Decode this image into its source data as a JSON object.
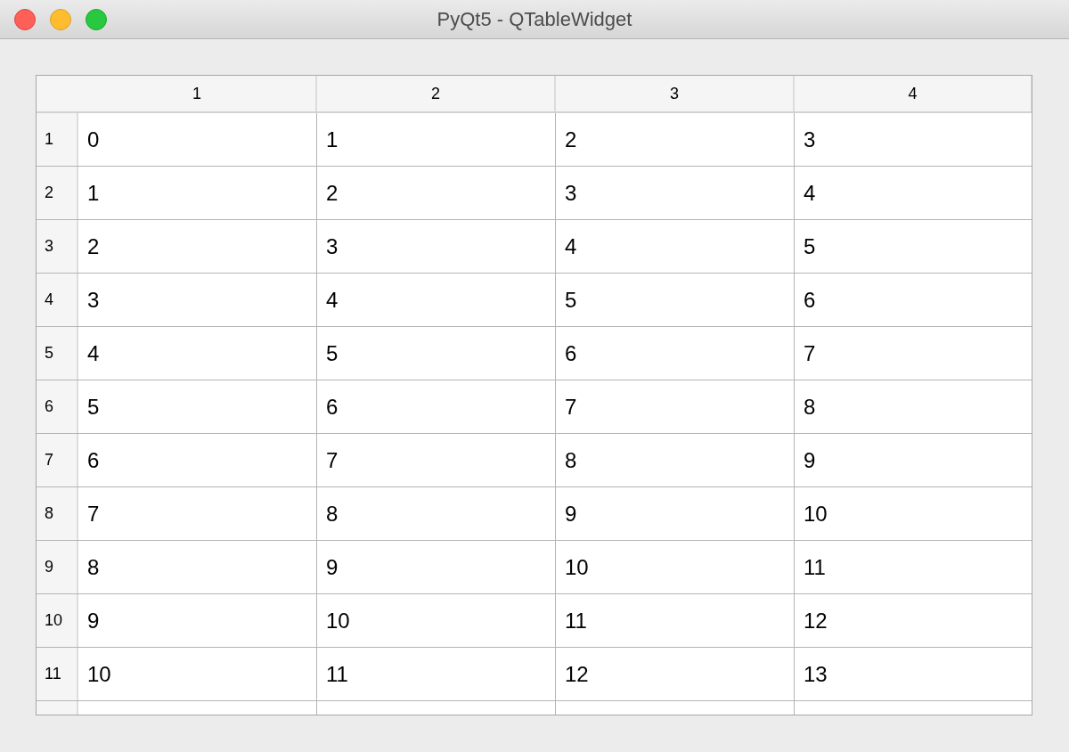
{
  "window": {
    "title": "PyQt5 - QTableWidget"
  },
  "table": {
    "columns": [
      "1",
      "2",
      "3",
      "4"
    ],
    "rows": [
      {
        "header": "1",
        "cells": [
          "0",
          "1",
          "2",
          "3"
        ]
      },
      {
        "header": "2",
        "cells": [
          "1",
          "2",
          "3",
          "4"
        ]
      },
      {
        "header": "3",
        "cells": [
          "2",
          "3",
          "4",
          "5"
        ]
      },
      {
        "header": "4",
        "cells": [
          "3",
          "4",
          "5",
          "6"
        ]
      },
      {
        "header": "5",
        "cells": [
          "4",
          "5",
          "6",
          "7"
        ]
      },
      {
        "header": "6",
        "cells": [
          "5",
          "6",
          "7",
          "8"
        ]
      },
      {
        "header": "7",
        "cells": [
          "6",
          "7",
          "8",
          "9"
        ]
      },
      {
        "header": "8",
        "cells": [
          "7",
          "8",
          "9",
          "10"
        ]
      },
      {
        "header": "9",
        "cells": [
          "8",
          "9",
          "10",
          "11"
        ]
      },
      {
        "header": "10",
        "cells": [
          "9",
          "10",
          "11",
          "12"
        ]
      },
      {
        "header": "11",
        "cells": [
          "10",
          "11",
          "12",
          "13"
        ]
      }
    ]
  }
}
